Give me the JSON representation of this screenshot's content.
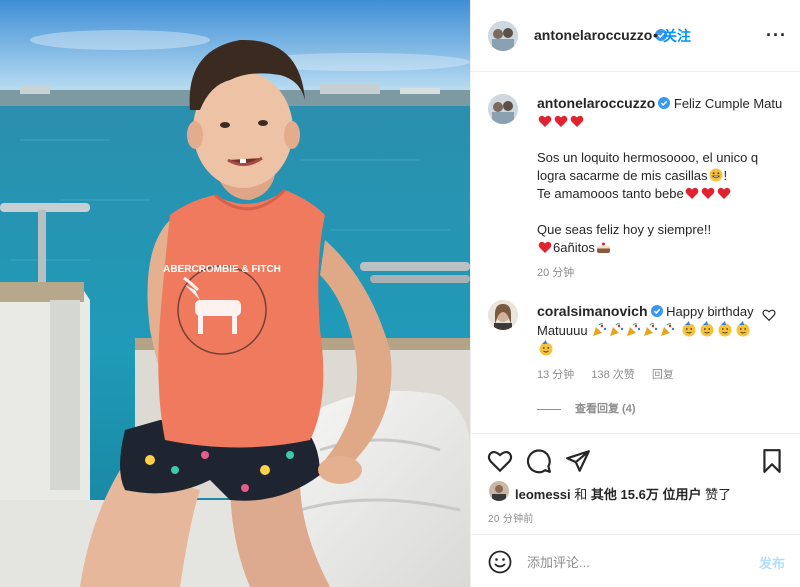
{
  "post": {
    "image_alt": "Boy in orange sleeveless shirt sitting on a boat",
    "shirt_text": "ABERCROMBIE & FITCH",
    "author": {
      "username": "antonelaroccuzzo",
      "verified": true,
      "follow_label": "关注",
      "separator": "•",
      "more_label": "···"
    },
    "caption": {
      "username": "antonelaroccuzzo",
      "line1": "Feliz Cumple Matu",
      "line2": "Sos un loquito hermosoooo, el unico q logra sacarme de mis casillas",
      "line2_end": "!",
      "line3": "Te amamooos tanto bebe",
      "line4": "Que seas feliz hoy y siempre!!",
      "line5": "6añitos",
      "time": "20 分钟"
    },
    "comment": {
      "username": "coralsimanovich",
      "text": "Happy birthday Matuuuu",
      "time": "13 分钟",
      "likes": "138 次赞",
      "reply_label": "回复",
      "view_replies": "查看回复 (4)"
    },
    "likes": {
      "user": "leomessi",
      "and": "和",
      "others": "其他 15.6万 位用户",
      "liked": "赞了"
    },
    "timestamp": "20 分钟前",
    "add_comment": {
      "placeholder": "添加评论...",
      "post_label": "发布"
    }
  },
  "colors": {
    "link_blue": "#0095f6",
    "post_disabled": "#b2dffc",
    "meta_grey": "#8e8e8e",
    "heart_red": "#ed4956"
  },
  "icons": [
    "verified-badge-icon",
    "more-icon",
    "heart-icon",
    "comment-icon",
    "share-icon",
    "bookmark-icon",
    "smile-icon",
    "red-heart-emoji",
    "grin-emoji",
    "cake-emoji",
    "party-popper-emoji",
    "partying-face-emoji"
  ]
}
